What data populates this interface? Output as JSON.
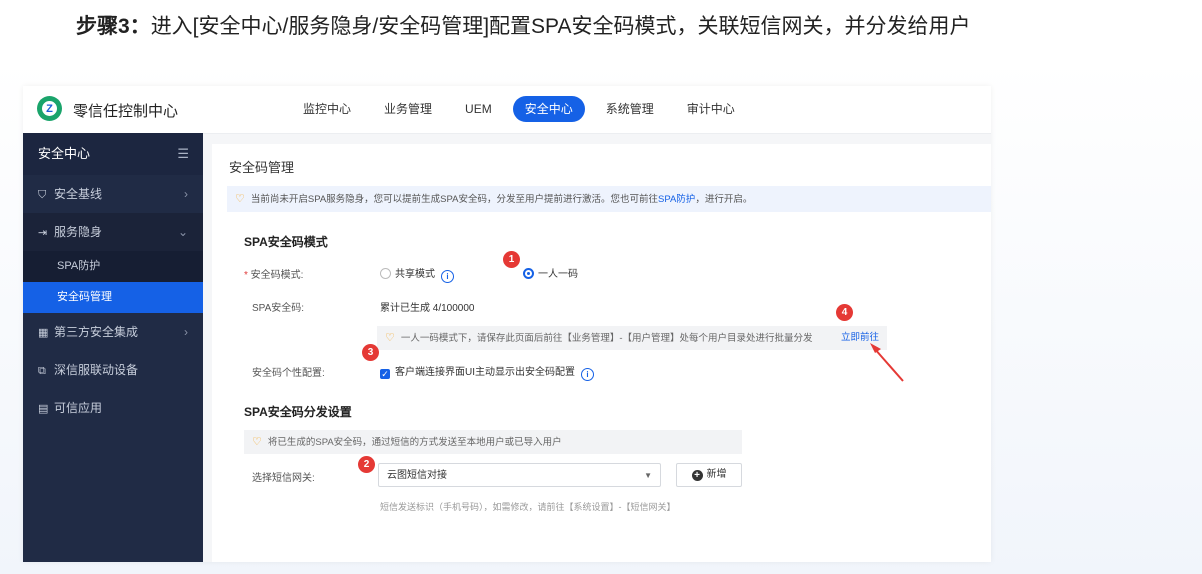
{
  "step": {
    "bold": "步骤3：",
    "text": "进入[安全中心/服务隐身/安全码管理]配置SPA安全码模式，关联短信网关，并分发给用户"
  },
  "app": {
    "title": "零信任控制中心",
    "nav": [
      "监控中心",
      "业务管理",
      "UEM",
      "安全中心",
      "系统管理",
      "审计中心"
    ],
    "active_nav": "安全中心"
  },
  "sidebar": {
    "header": "安全中心",
    "items": [
      {
        "label": "安全基线",
        "icon": "shield-icon"
      },
      {
        "label": "服务隐身",
        "icon": "login-icon"
      },
      {
        "label": "第三方安全集成",
        "icon": "grid-icon"
      },
      {
        "label": "深信服联动设备",
        "icon": "link-icon"
      },
      {
        "label": "可信应用",
        "icon": "doc-icon"
      }
    ],
    "sub_items": [
      "SPA防护",
      "安全码管理"
    ]
  },
  "main": {
    "title": "安全码管理",
    "alert_prefix": "当前尚未开启SPA服务隐身，您可以提前生成SPA安全码，分发至用户提前进行激活。您也可前往",
    "alert_link": "SPA防护",
    "alert_suffix": "，进行开启。",
    "mode_section": {
      "title": "SPA安全码模式",
      "mode_label": "安全码模式:",
      "option_shared": "共享模式",
      "option_one": "一人一码",
      "code_label": "SPA安全码:",
      "code_value": "累计已生成 4/100000",
      "tip": "一人一码模式下，请保存此页面后前往【业务管理】-【用户管理】处每个用户目录处进行批量分发",
      "tip_link": "立即前往",
      "custom_label": "安全码个性配置:",
      "custom_option": "客户端连接界面UI主动显示出安全码配置"
    },
    "dist_section": {
      "title": "SPA安全码分发设置",
      "tip": "将已生成的SPA安全码，通过短信的方式发送至本地用户或已导入用户",
      "gateway_label": "选择短信网关:",
      "gateway_value": "云图短信对接",
      "add_button": "新增",
      "hint": "短信发送标识（手机号码），如需修改，请前往【系统设置】-【短信网关】"
    }
  },
  "badges": [
    "1",
    "2",
    "3",
    "4"
  ],
  "colors": {
    "accent": "#1561e6",
    "sidebar": "#202b45",
    "badge": "#e53935"
  }
}
